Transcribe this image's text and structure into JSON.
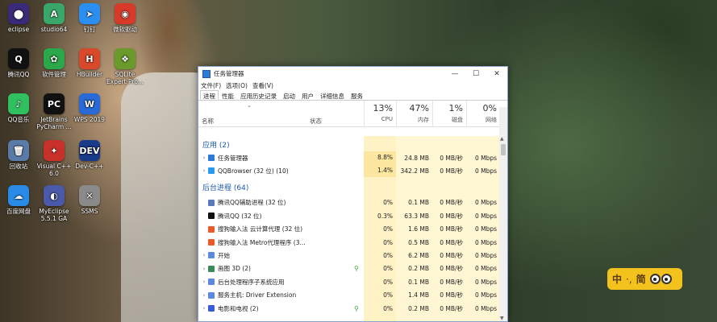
{
  "desktop": {
    "icons": [
      {
        "label": "eclipse",
        "glyph": "⬤",
        "color": "#3a2a7a"
      },
      {
        "label": "studio64",
        "glyph": "A",
        "color": "#3aa76a"
      },
      {
        "label": "钉钉",
        "glyph": "➤",
        "color": "#2a8ff0"
      },
      {
        "label": "微软驱动",
        "glyph": "◉",
        "color": "#d83a2a"
      },
      {
        "label": "腾讯QQ",
        "glyph": "Q",
        "color": "#111"
      },
      {
        "label": "软件管理",
        "glyph": "✿",
        "color": "#2aa84a"
      },
      {
        "label": "HBuilder",
        "glyph": "H",
        "color": "#d8482a"
      },
      {
        "label": "SQLite Expert Pro...",
        "glyph": "❖",
        "color": "#6a9a2a"
      },
      {
        "label": "QQ音乐",
        "glyph": "♪",
        "color": "#30c060"
      },
      {
        "label": "JetBrains PyCharm ...",
        "glyph": "PC",
        "color": "#111"
      },
      {
        "label": "WPS 2019",
        "glyph": "W",
        "color": "#2a6ad8"
      },
      {
        "label": "回收站",
        "glyph": "🗑",
        "color": "#5a7aa8"
      },
      {
        "label": "Visual C++ 6.0",
        "glyph": "✦",
        "color": "#c8302a"
      },
      {
        "label": "Dev-C++",
        "glyph": "DEV",
        "color": "#1a3a8a"
      },
      {
        "label": "百度网盘",
        "glyph": "☁",
        "color": "#2a8ae8"
      },
      {
        "label": "MyEclipse 5.5.1 GA",
        "glyph": "◐",
        "color": "#4a5aa8"
      },
      {
        "label": "SSMS",
        "glyph": "✕",
        "color": "#8a8a8a"
      }
    ]
  },
  "window": {
    "title": "任务管理器",
    "minimize": "—",
    "maximize": "☐",
    "close": "✕",
    "menu": [
      "文件(F)",
      "选项(O)",
      "查看(V)"
    ],
    "tabs": [
      "进程",
      "性能",
      "应用历史记录",
      "启动",
      "用户",
      "详细信息",
      "服务"
    ],
    "columns": {
      "sort_glyph": "⌄",
      "name": "名称",
      "status": "状态",
      "cpu_pct": "13%",
      "cpu_label": "CPU",
      "mem_pct": "47%",
      "mem_label": "内存",
      "disk_pct": "1%",
      "disk_label": "磁盘",
      "net_pct": "0%",
      "net_label": "网络"
    },
    "groups": {
      "apps": "应用 (2)",
      "background": "后台进程 (64)"
    },
    "apps": [
      {
        "name": "任务管理器",
        "cpu": "8.8%",
        "mem": "24.8 MB",
        "disk": "0 MB/秒",
        "net": "0 Mbps",
        "icon": "#2c7bd6",
        "expand": "›"
      },
      {
        "name": "QQBrowser (32 位) (10)",
        "cpu": "1.4%",
        "mem": "342.2 MB",
        "disk": "0 MB/秒",
        "net": "0 Mbps",
        "icon": "#2a9af0",
        "expand": "›"
      }
    ],
    "background": [
      {
        "name": "腾讯QQ辅助进程 (32 位)",
        "cpu": "0%",
        "mem": "0.1 MB",
        "disk": "0 MB/秒",
        "net": "0 Mbps",
        "icon": "#5a7ab8",
        "expand": "",
        "leaf": false
      },
      {
        "name": "腾讯QQ (32 位)",
        "cpu": "0.3%",
        "mem": "63.3 MB",
        "disk": "0 MB/秒",
        "net": "0 Mbps",
        "icon": "#111",
        "expand": "",
        "leaf": false
      },
      {
        "name": "搜狗输入法 云计算代理 (32 位)",
        "cpu": "0%",
        "mem": "1.6 MB",
        "disk": "0 MB/秒",
        "net": "0 Mbps",
        "icon": "#e85a2a",
        "expand": "",
        "leaf": false
      },
      {
        "name": "搜狗输入法 Metro代理程序 (3...",
        "cpu": "0%",
        "mem": "0.5 MB",
        "disk": "0 MB/秒",
        "net": "0 Mbps",
        "icon": "#e85a2a",
        "expand": "",
        "leaf": false
      },
      {
        "name": "开始",
        "cpu": "0%",
        "mem": "6.2 MB",
        "disk": "0 MB/秒",
        "net": "0 Mbps",
        "icon": "#5a8ad8",
        "expand": "›",
        "leaf": false
      },
      {
        "name": "画图 3D (2)",
        "cpu": "0%",
        "mem": "0.2 MB",
        "disk": "0 MB/秒",
        "net": "0 Mbps",
        "icon": "#3a8a5a",
        "expand": "›",
        "leaf": true
      },
      {
        "name": "后台处理程序子系统应用",
        "cpu": "0%",
        "mem": "0.1 MB",
        "disk": "0 MB/秒",
        "net": "0 Mbps",
        "icon": "#5a8ad8",
        "expand": "›",
        "leaf": false
      },
      {
        "name": "服务主机: Driver Extension",
        "cpu": "0%",
        "mem": "1.4 MB",
        "disk": "0 MB/秒",
        "net": "0 Mbps",
        "icon": "#5a8ad8",
        "expand": "›",
        "leaf": false
      },
      {
        "name": "电影和电视 (2)",
        "cpu": "0%",
        "mem": "0.2 MB",
        "disk": "0 MB/秒",
        "net": "0 Mbps",
        "icon": "#3a5ad8",
        "expand": "›",
        "leaf": true
      }
    ],
    "leaf_glyph": "⚲",
    "scroll_up": "▲",
    "scroll_down": "▼"
  },
  "ime": {
    "mode": "中",
    "separator": "·,",
    "script": "简"
  },
  "colors": {
    "cpu_bg": "#fff2c4",
    "cpu_bg_hi": "#fde7a0",
    "mem_bg": "#fff6d4",
    "group_text": "#1e5aa8"
  }
}
